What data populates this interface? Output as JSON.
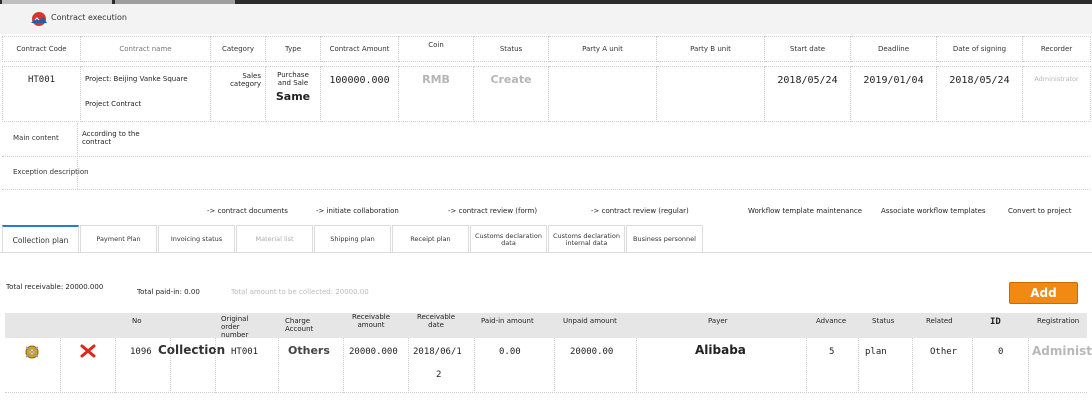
{
  "app": {
    "title": "Contract execution",
    "logo_icon": "mountain-logo-icon"
  },
  "contract_headers": [
    "Contract Code",
    "Contract name",
    "Category",
    "Type",
    "Contract Amount",
    "Coin",
    "Status",
    "Party A unit",
    "Party B unit",
    "Start date",
    "Deadline",
    "Date of signing",
    "Recorder"
  ],
  "contract": {
    "code": "HT001",
    "name_line1": "Project: Beijing Vanke Square",
    "name_line2": "Project Contract",
    "category": "Sales category",
    "type": "Purchase and Sale",
    "type_overlay": "Same",
    "amount": "100000.000",
    "coin": "RMB",
    "status": "Create",
    "party_a": "",
    "party_b": "",
    "start_date": "2018/05/24",
    "deadline": "2019/01/04",
    "signing_date": "2018/05/24",
    "recorder": "Administrator"
  },
  "main_content": {
    "label": "Main content",
    "value": "According to the contract"
  },
  "exception": {
    "label": "Exception description",
    "value": ""
  },
  "actions": [
    "-> contract documents",
    "-> initiate collaboration",
    "-> contract review (form)",
    "-> contract review (regular)",
    "Workflow template maintenance",
    "Associate workflow templates",
    "Convert to project"
  ],
  "tabs": [
    "Collection plan",
    "Payment Plan",
    "Invoicing status",
    "Material list",
    "Shipping plan",
    "Receipt plan",
    "Customs declaration data",
    "Customs declaration internal data",
    "Business personnel"
  ],
  "totals": {
    "receivable_label": "Total receivable: 20000.000",
    "paid_label": "Total paid-in: 0.00",
    "to_collect_label": "Total amount to be collected: 20000.00"
  },
  "add_button": "Add",
  "list_headers": [
    "No",
    "Original order number",
    "Charge Account",
    "Receivable amount",
    "Receivable date",
    "Paid-in amount",
    "Unpaid amount",
    "Payer",
    "Advance",
    "Status",
    "Related",
    "ID",
    "Registration"
  ],
  "row": {
    "no": "1096",
    "no_overlay": "Collection",
    "order_number": "HT001",
    "charge_account": "Others",
    "receivable_amount": "20000.000",
    "receivable_date_1": "2018/06/1",
    "receivable_date_2": "2",
    "paid_in": "0.00",
    "unpaid": "20000.00",
    "payer": "Alibaba",
    "advance": "5",
    "status": "plan",
    "related": "Other",
    "id": "0",
    "registration": "Administ"
  },
  "colors": {
    "accent": "#2a7ad5",
    "add_button": "#f08a12",
    "edit": "#d4a020",
    "delete": "#e0251b"
  }
}
